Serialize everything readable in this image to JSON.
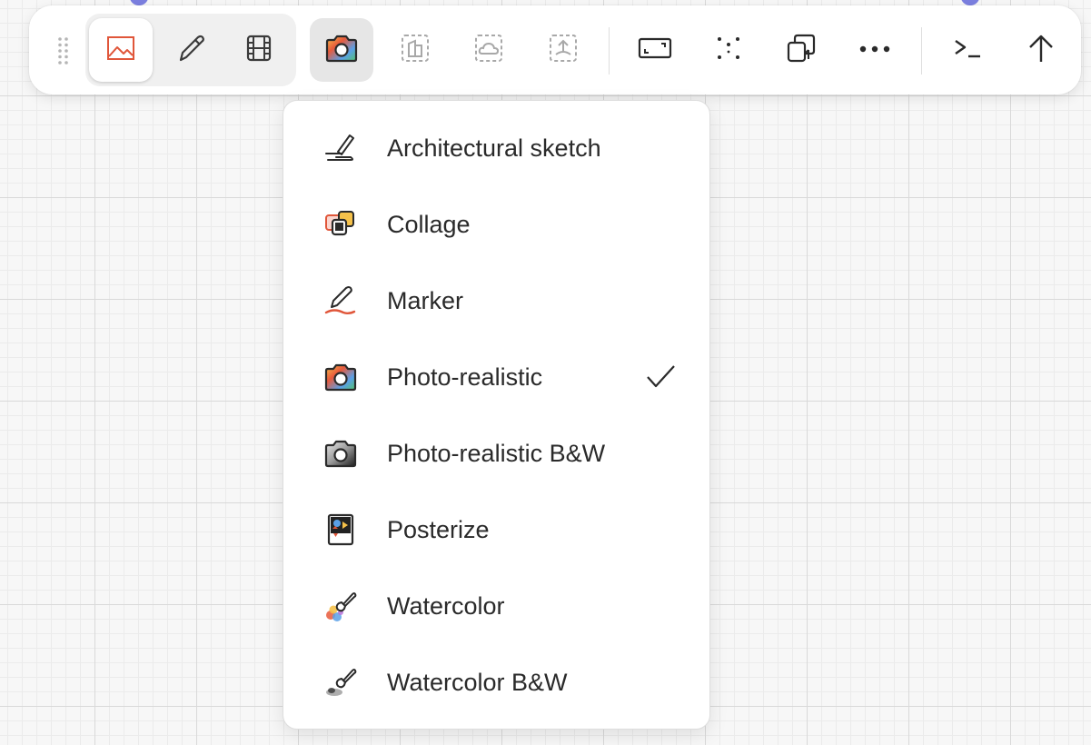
{
  "colors": {
    "accent": "#e0563a",
    "icon": "#3a3a3a",
    "icon_disabled": "#a8a8a8",
    "toolbar_bg": "#ffffff",
    "canvas_bg": "#f7f7f7",
    "peek_dot": "#7b7fe0"
  },
  "toolbar": {
    "tools": [
      {
        "icon": "image-icon",
        "state": "selected"
      },
      {
        "icon": "pencil-icon",
        "state": "normal"
      },
      {
        "icon": "film-icon",
        "state": "normal"
      },
      {
        "icon": "color-camera-icon",
        "state": "active"
      },
      {
        "icon": "building-frame-icon",
        "state": "disabled"
      },
      {
        "icon": "cloud-frame-icon",
        "state": "disabled"
      },
      {
        "icon": "upload-frame-icon",
        "state": "disabled"
      },
      {
        "icon": "aspect-ratio-icon",
        "state": "normal"
      },
      {
        "icon": "scatter-dots-icon",
        "state": "normal"
      },
      {
        "icon": "variations-icon",
        "state": "normal"
      },
      {
        "icon": "more-icon",
        "state": "normal"
      },
      {
        "icon": "terminal-icon",
        "state": "normal"
      },
      {
        "icon": "arrow-up-icon",
        "state": "normal"
      }
    ]
  },
  "style_menu": {
    "selected": "Photo-realistic",
    "items": [
      {
        "label": "Architectural sketch",
        "icon": "sketch-pen-icon"
      },
      {
        "label": "Collage",
        "icon": "collage-icon"
      },
      {
        "label": "Marker",
        "icon": "marker-icon"
      },
      {
        "label": "Photo-realistic",
        "icon": "color-camera-icon"
      },
      {
        "label": "Photo-realistic B&W",
        "icon": "bw-camera-icon"
      },
      {
        "label": "Posterize",
        "icon": "posterize-icon"
      },
      {
        "label": "Watercolor",
        "icon": "watercolor-brush-icon"
      },
      {
        "label": "Watercolor B&W",
        "icon": "bw-brush-icon"
      }
    ]
  }
}
